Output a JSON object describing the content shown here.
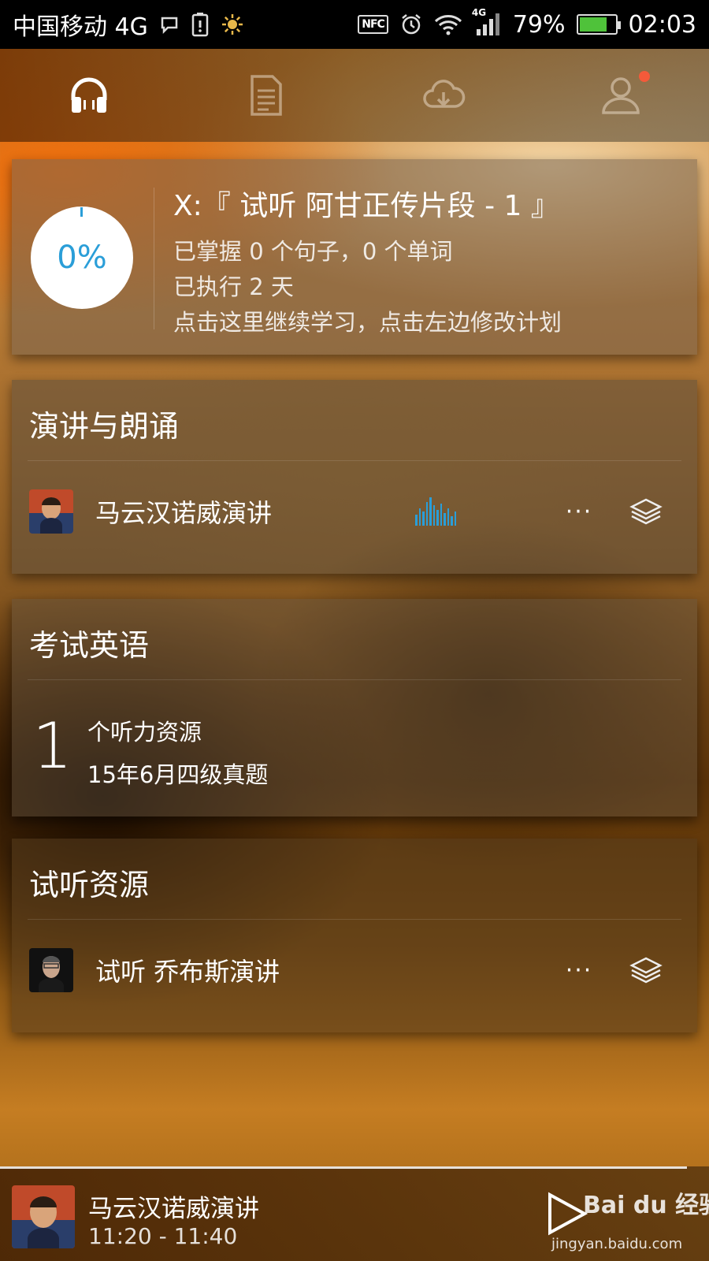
{
  "status_bar": {
    "carrier": "中国移动 4G",
    "nfc_label": "NFC",
    "network_label": "4G",
    "battery_percent": "79%",
    "battery_level": 0.79,
    "time": "02:03"
  },
  "tabs": [
    {
      "icon": "headphones-icon",
      "active": true
    },
    {
      "icon": "document-icon",
      "active": false
    },
    {
      "icon": "cloud-download-icon",
      "active": false
    },
    {
      "icon": "user-icon",
      "active": false,
      "has_notification": true
    }
  ],
  "plan": {
    "progress_label": "0%",
    "progress_value": 0,
    "title": "X:『 试听 阿甘正传片段 - 1 』",
    "mastered": "已掌握 0 个句子，0 个单词",
    "executed": "已执行 2 天",
    "hint": "点击这里继续学习，点击左边修改计划"
  },
  "speech_section": {
    "title": "演讲与朗诵",
    "item_label": "马云汉诺威演讲",
    "more_label": "···"
  },
  "exam_section": {
    "title": "考试英语",
    "count": "1",
    "unit": "个听力资源",
    "resource_name": "15年6月四级真题"
  },
  "trial_section": {
    "title": "试听资源",
    "item_label": "试听 乔布斯演讲",
    "more_label": "···"
  },
  "player": {
    "title": "马云汉诺威演讲",
    "time_range": "11:20 - 11:40"
  },
  "watermark": {
    "brand": "Bai du 经验",
    "url": "jingyan.baidu.com"
  },
  "colors": {
    "accent_blue": "#2a9ed8",
    "notification_red": "#f45a3a",
    "battery_green": "#4fc23a"
  }
}
